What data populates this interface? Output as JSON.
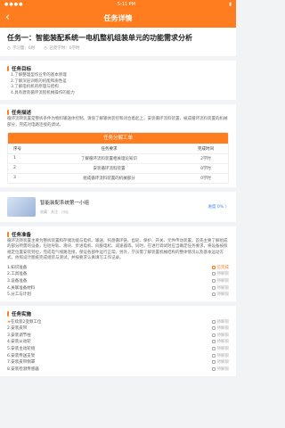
{
  "status_bar": {
    "left": "●●●● ",
    "time": "5:11 PM",
    "right": "▮"
  },
  "nav": {
    "back_icon": "chevron-left-icon",
    "title": "任务详情"
  },
  "task": {
    "title": "任务一：智能装配系统一电机整机组装单元的功能需求分析",
    "meta": {
      "hours": "学习量：6时",
      "completed": "已完学时：0学时"
    }
  },
  "goals": {
    "title": "任务目标",
    "lines": [
      "1.了解整理型作业专的基本原理",
      "2.了解深层训练的机能和质性差",
      "3.了解电机机的原理与结构",
      "4.具有建装循环流程机械操作的能力"
    ]
  },
  "description": {
    "title": "任务描述",
    "text": "循环流转装置是整拆条件为物料输送体控制。请值了解输体装控和闭合着起上，安装循环流料装置、被成循环流料装置的机械部分，完成对电路连接的调试。"
  },
  "work_table": {
    "title": "任务分解工单",
    "columns": [
      "序号",
      "任务要求",
      "完成时间"
    ],
    "rows": [
      [
        "1",
        "了解循环流料装置相关理论知识",
        "2学时"
      ],
      [
        "2",
        "安装循环流料装置",
        "0学时"
      ],
      [
        "3",
        "组成循环流料装置的机械部分",
        "0学时"
      ]
    ]
  },
  "course": {
    "name": "智能装配系统第一小组",
    "stats": [
      "收藏",
      "关注",
      "讨论"
    ],
    "progress": "进度 0% 〉"
  },
  "prep": {
    "title": "任务准备",
    "text": "循环流转装置主要为整拆装置和存储功能与电机、输送、托盘循环链、齿轮、保护、开关、元件传动装置。首先主要了解组成的部分所需的设备，包括导轨、滑块、步进电机、伺服电机、减速器等。同时，在进行调试时应当确定任务要求，将设备按照规定位置安装到位，完成电气线路连接，保证各部件运行正常。另外，学员需了解装置机械结构的整体情况以及基本运动方式，依照设计图纸完成组装与测试，并按要求认真填写工作记录。",
    "items": [
      {
        "label": "1.知识准备",
        "status": "已完成",
        "done": true
      },
      {
        "label": "2.工具准备",
        "status": "待解锁",
        "done": false
      },
      {
        "label": "3.设备准备",
        "status": "待解锁",
        "done": false
      },
      {
        "label": "4.关联准备材料",
        "status": "待解锁",
        "done": false
      },
      {
        "label": "5.分工与计划",
        "status": "待解锁",
        "done": false
      }
    ]
  },
  "impl": {
    "title": "任务实施",
    "items": [
      {
        "label": "在续装2变频工位",
        "status": "待解锁",
        "star": true
      },
      {
        "label": "2.安装皮带",
        "status": "待解锁"
      },
      {
        "label": "3.安装调节柱",
        "status": "待解锁"
      },
      {
        "label": "4.安装从动轮",
        "status": "待解锁"
      },
      {
        "label": "5.安装主动轮组",
        "status": "待解锁"
      },
      {
        "label": "6.安装传送支架",
        "status": "待解锁"
      },
      {
        "label": "7.安装皮带侧罩",
        "status": "待解锁"
      },
      {
        "label": "8.安装检测传感器",
        "status": "待解锁"
      }
    ]
  }
}
